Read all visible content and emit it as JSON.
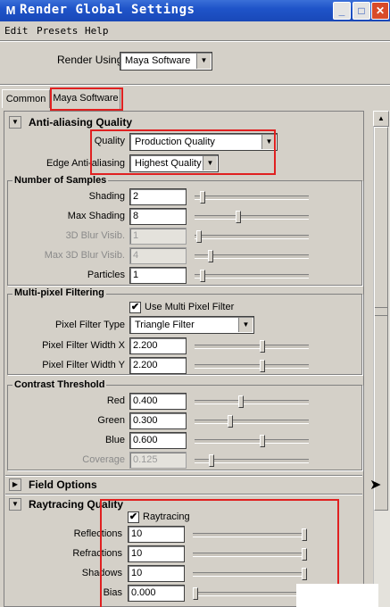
{
  "window": {
    "title": "Render Global Settings",
    "icon": "maya-icon",
    "buttons": {
      "minimize": "_",
      "maximize": "□",
      "close": "✕"
    }
  },
  "menu": [
    "Edit",
    "Presets",
    "Help"
  ],
  "render_using": {
    "label": "Render Using",
    "value": "Maya Software"
  },
  "tabs": [
    {
      "label": "Common"
    },
    {
      "label": "Maya Software",
      "active": true
    }
  ],
  "anti_aliasing": {
    "title": "Anti-aliasing Quality",
    "quality_label": "Quality",
    "quality_value": "Production Quality",
    "edge_label": "Edge Anti-aliasing",
    "edge_value": "Highest Quality"
  },
  "samples": {
    "title": "Number of Samples",
    "rows": [
      {
        "label": "Shading",
        "value": "2",
        "level": 0.05,
        "disabled": false
      },
      {
        "label": "Max Shading",
        "value": "8",
        "level": 0.38,
        "disabled": false
      },
      {
        "label": "3D Blur Visib.",
        "value": "1",
        "level": 0.02,
        "disabled": true
      },
      {
        "label": "Max 3D Blur Visib.",
        "value": "4",
        "level": 0.12,
        "disabled": true
      },
      {
        "label": "Particles",
        "value": "1",
        "level": 0.05,
        "disabled": false
      }
    ]
  },
  "multipixel": {
    "title": "Multi-pixel Filtering",
    "use_label": "Use Multi Pixel Filter",
    "use_checked": true,
    "filter_type_label": "Pixel Filter Type",
    "filter_type_value": "Triangle Filter",
    "rows": [
      {
        "label": "Pixel Filter Width X",
        "value": "2.200",
        "level": 0.6
      },
      {
        "label": "Pixel Filter Width Y",
        "value": "2.200",
        "level": 0.6
      }
    ]
  },
  "contrast": {
    "title": "Contrast Threshold",
    "rows": [
      {
        "label": "Red",
        "value": "0.400",
        "level": 0.4,
        "disabled": false
      },
      {
        "label": "Green",
        "value": "0.300",
        "level": 0.3,
        "disabled": false
      },
      {
        "label": "Blue",
        "value": "0.600",
        "level": 0.6,
        "disabled": false
      },
      {
        "label": "Coverage",
        "value": "0.125",
        "level": 0.13,
        "disabled": true
      }
    ]
  },
  "field_options": {
    "title": "Field Options"
  },
  "raytracing": {
    "title": "Raytracing Quality",
    "checkbox_label": "Raytracing",
    "checked": true,
    "rows": [
      {
        "label": "Reflections",
        "value": "10",
        "level": 1.0
      },
      {
        "label": "Refractions",
        "value": "10",
        "level": 1.0
      },
      {
        "label": "Shadows",
        "value": "10",
        "level": 1.0
      },
      {
        "label": "Bias",
        "value": "0.000",
        "level": 0.0
      }
    ]
  },
  "colors": {
    "highlight": "#e02020",
    "titlebar": "#1f54c9",
    "background": "#d4d0c8"
  }
}
